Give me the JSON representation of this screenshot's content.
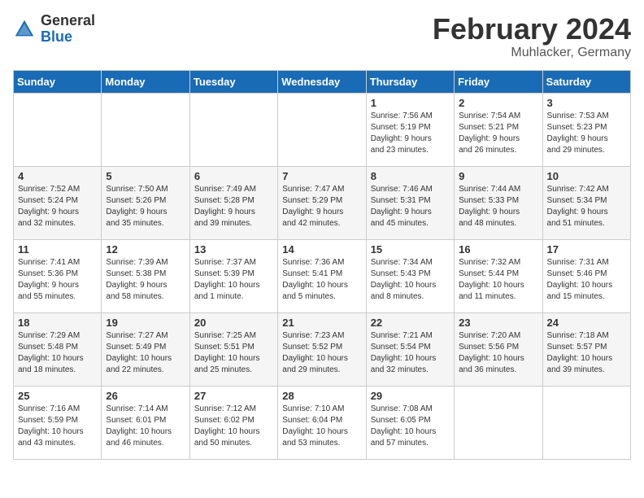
{
  "logo": {
    "general": "General",
    "blue": "Blue"
  },
  "title": "February 2024",
  "subtitle": "Muhlacker, Germany",
  "weekdays": [
    "Sunday",
    "Monday",
    "Tuesday",
    "Wednesday",
    "Thursday",
    "Friday",
    "Saturday"
  ],
  "weeks": [
    [
      {
        "day": "",
        "info": ""
      },
      {
        "day": "",
        "info": ""
      },
      {
        "day": "",
        "info": ""
      },
      {
        "day": "",
        "info": ""
      },
      {
        "day": "1",
        "info": "Sunrise: 7:56 AM\nSunset: 5:19 PM\nDaylight: 9 hours\nand 23 minutes."
      },
      {
        "day": "2",
        "info": "Sunrise: 7:54 AM\nSunset: 5:21 PM\nDaylight: 9 hours\nand 26 minutes."
      },
      {
        "day": "3",
        "info": "Sunrise: 7:53 AM\nSunset: 5:23 PM\nDaylight: 9 hours\nand 29 minutes."
      }
    ],
    [
      {
        "day": "4",
        "info": "Sunrise: 7:52 AM\nSunset: 5:24 PM\nDaylight: 9 hours\nand 32 minutes."
      },
      {
        "day": "5",
        "info": "Sunrise: 7:50 AM\nSunset: 5:26 PM\nDaylight: 9 hours\nand 35 minutes."
      },
      {
        "day": "6",
        "info": "Sunrise: 7:49 AM\nSunset: 5:28 PM\nDaylight: 9 hours\nand 39 minutes."
      },
      {
        "day": "7",
        "info": "Sunrise: 7:47 AM\nSunset: 5:29 PM\nDaylight: 9 hours\nand 42 minutes."
      },
      {
        "day": "8",
        "info": "Sunrise: 7:46 AM\nSunset: 5:31 PM\nDaylight: 9 hours\nand 45 minutes."
      },
      {
        "day": "9",
        "info": "Sunrise: 7:44 AM\nSunset: 5:33 PM\nDaylight: 9 hours\nand 48 minutes."
      },
      {
        "day": "10",
        "info": "Sunrise: 7:42 AM\nSunset: 5:34 PM\nDaylight: 9 hours\nand 51 minutes."
      }
    ],
    [
      {
        "day": "11",
        "info": "Sunrise: 7:41 AM\nSunset: 5:36 PM\nDaylight: 9 hours\nand 55 minutes."
      },
      {
        "day": "12",
        "info": "Sunrise: 7:39 AM\nSunset: 5:38 PM\nDaylight: 9 hours\nand 58 minutes."
      },
      {
        "day": "13",
        "info": "Sunrise: 7:37 AM\nSunset: 5:39 PM\nDaylight: 10 hours\nand 1 minute."
      },
      {
        "day": "14",
        "info": "Sunrise: 7:36 AM\nSunset: 5:41 PM\nDaylight: 10 hours\nand 5 minutes."
      },
      {
        "day": "15",
        "info": "Sunrise: 7:34 AM\nSunset: 5:43 PM\nDaylight: 10 hours\nand 8 minutes."
      },
      {
        "day": "16",
        "info": "Sunrise: 7:32 AM\nSunset: 5:44 PM\nDaylight: 10 hours\nand 11 minutes."
      },
      {
        "day": "17",
        "info": "Sunrise: 7:31 AM\nSunset: 5:46 PM\nDaylight: 10 hours\nand 15 minutes."
      }
    ],
    [
      {
        "day": "18",
        "info": "Sunrise: 7:29 AM\nSunset: 5:48 PM\nDaylight: 10 hours\nand 18 minutes."
      },
      {
        "day": "19",
        "info": "Sunrise: 7:27 AM\nSunset: 5:49 PM\nDaylight: 10 hours\nand 22 minutes."
      },
      {
        "day": "20",
        "info": "Sunrise: 7:25 AM\nSunset: 5:51 PM\nDaylight: 10 hours\nand 25 minutes."
      },
      {
        "day": "21",
        "info": "Sunrise: 7:23 AM\nSunset: 5:52 PM\nDaylight: 10 hours\nand 29 minutes."
      },
      {
        "day": "22",
        "info": "Sunrise: 7:21 AM\nSunset: 5:54 PM\nDaylight: 10 hours\nand 32 minutes."
      },
      {
        "day": "23",
        "info": "Sunrise: 7:20 AM\nSunset: 5:56 PM\nDaylight: 10 hours\nand 36 minutes."
      },
      {
        "day": "24",
        "info": "Sunrise: 7:18 AM\nSunset: 5:57 PM\nDaylight: 10 hours\nand 39 minutes."
      }
    ],
    [
      {
        "day": "25",
        "info": "Sunrise: 7:16 AM\nSunset: 5:59 PM\nDaylight: 10 hours\nand 43 minutes."
      },
      {
        "day": "26",
        "info": "Sunrise: 7:14 AM\nSunset: 6:01 PM\nDaylight: 10 hours\nand 46 minutes."
      },
      {
        "day": "27",
        "info": "Sunrise: 7:12 AM\nSunset: 6:02 PM\nDaylight: 10 hours\nand 50 minutes."
      },
      {
        "day": "28",
        "info": "Sunrise: 7:10 AM\nSunset: 6:04 PM\nDaylight: 10 hours\nand 53 minutes."
      },
      {
        "day": "29",
        "info": "Sunrise: 7:08 AM\nSunset: 6:05 PM\nDaylight: 10 hours\nand 57 minutes."
      },
      {
        "day": "",
        "info": ""
      },
      {
        "day": "",
        "info": ""
      }
    ]
  ]
}
